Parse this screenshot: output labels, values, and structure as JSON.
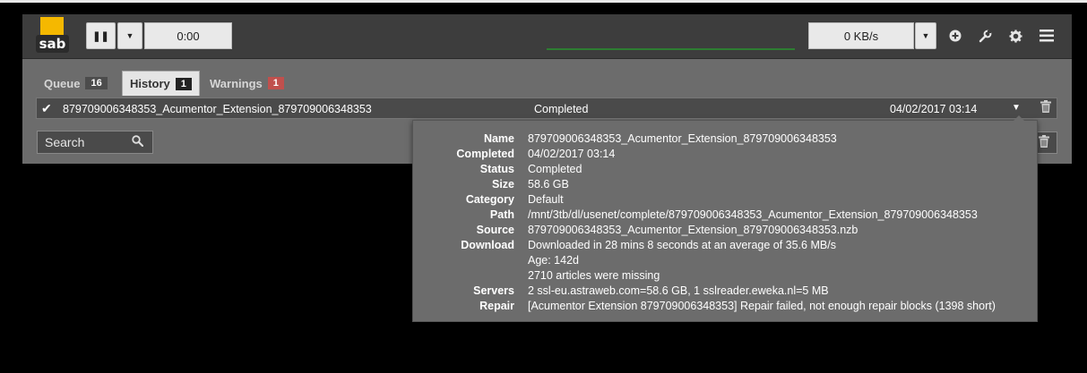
{
  "colors": {
    "accent": "#f5b800",
    "error_badge": "#c0504d",
    "progress": "#2e7d32"
  },
  "logo_text": "sab",
  "toolbar": {
    "pause_icon": "pause-icon",
    "caret": "▾",
    "timer": "0:00",
    "speed": "0 KB/s"
  },
  "tabs": [
    {
      "label": "Queue",
      "count": "16"
    },
    {
      "label": "History",
      "count": "1"
    },
    {
      "label": "Warnings",
      "count": "1"
    }
  ],
  "history_row": {
    "name": "879709006348353_Acumentor_Extension_879709006348353",
    "status": "Completed",
    "date": "04/02/2017 03:14"
  },
  "search": {
    "placeholder": "Search"
  },
  "details": [
    {
      "label": "Name",
      "value": "879709006348353_Acumentor_Extension_879709006348353"
    },
    {
      "label": "Completed",
      "value": "04/02/2017 03:14"
    },
    {
      "label": "Status",
      "value": "Completed"
    },
    {
      "label": "Size",
      "value": "58.6 GB"
    },
    {
      "label": "Category",
      "value": "Default"
    },
    {
      "label": "Path",
      "value": "/mnt/3tb/dl/usenet/complete/879709006348353_Acumentor_Extension_879709006348353"
    },
    {
      "label": "Source",
      "value": "879709006348353_Acumentor_Extension_879709006348353.nzb"
    },
    {
      "label": "Download",
      "value": "Downloaded in 28 mins 8 seconds at an average of 35.6 MB/s"
    },
    {
      "label": "",
      "value": "Age: 142d"
    },
    {
      "label": "",
      "value": "2710 articles were missing"
    },
    {
      "label": "Servers",
      "value": "2 ssl-eu.astraweb.com=58.6 GB, 1 sslreader.eweka.nl=5 MB"
    },
    {
      "label": "Repair",
      "value": "[Acumentor Extension 879709006348353] Repair failed, not enough repair blocks (1398 short)"
    }
  ]
}
